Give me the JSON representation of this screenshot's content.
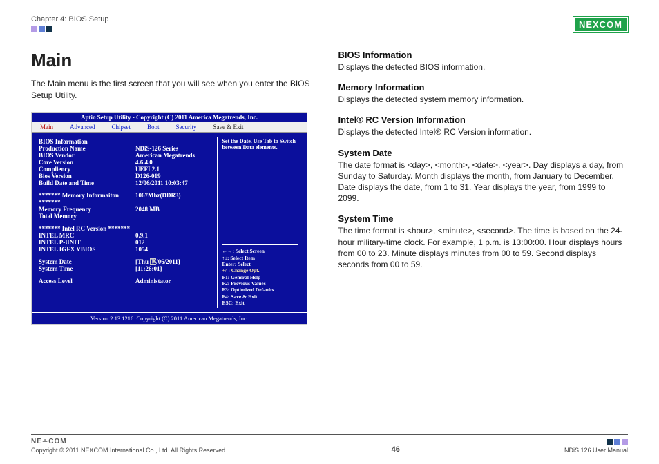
{
  "header": {
    "chapter": "Chapter 4: BIOS Setup",
    "logo_text": "NEXCOM"
  },
  "left": {
    "title": "Main",
    "intro": "The Main menu is the first screen that you will see when you enter the BIOS Setup Utility."
  },
  "bios": {
    "topbar": "Aptio Setup Utility - Copyright (C) 2011 America Megatrends, Inc.",
    "tabs": {
      "main": "Main",
      "advanced": "Advanced",
      "chipset": "Chipset",
      "boot": "Boot",
      "security": "Security",
      "save": "Save & Exit"
    },
    "info_header": "BIOS Information",
    "rows": {
      "production_name": {
        "label": "Production Name",
        "value": "NDiS-126 Series"
      },
      "bios_vendor": {
        "label": "BIOS Vendor",
        "value": "American Megatrends"
      },
      "core_version": {
        "label": "Core Version",
        "value": "4.6.4.0"
      },
      "compliency": {
        "label": "Compliency",
        "value": "UEFI 2.1"
      },
      "bios_version": {
        "label": "Bios Version",
        "value": "D126-019"
      },
      "build_date": {
        "label": "Build Date and Time",
        "value": "12/06/2011  10:03:47"
      }
    },
    "mem_header": "******* Memory Informaiton *******",
    "mem": {
      "freq": {
        "label": "Memory Frequency",
        "value": "2048 MB"
      },
      "freq_suffix": "1067Mhz(DDR3)",
      "total": {
        "label": "Total Memory",
        "value": ""
      }
    },
    "rc_header": "******* Intel RC Version *******",
    "rc": {
      "mrc": {
        "label": "INTEL MRC",
        "value": "0.9.1"
      },
      "punit": {
        "label": "INTEL P-UNIT",
        "value": "012"
      },
      "vbios": {
        "label": "INTEL IGFX VBIOS",
        "value": "1054"
      }
    },
    "sysdate": {
      "label": "System Date",
      "value_pre": "[Thu ",
      "value_hi": "12",
      "value_post": "/06/2011]"
    },
    "systime": {
      "label": "System Time",
      "value": "[11:26:01]"
    },
    "access": {
      "label": "Access Level",
      "value": "Administator"
    },
    "help_top": "Set the Date. Use Tab to Switch between Data elements.",
    "keys": {
      "select_screen": "←→: Select Screen",
      "select_item": "↑↓: Select Item",
      "enter": "Enter: Select",
      "change": "+/-: Change Opt.",
      "f1": "F1: General Help",
      "f2": "F2: Previous Values",
      "f3": "F3: Optimized Defaults",
      "f4": "F4: Save & Exit",
      "esc": "ESC: Exit"
    },
    "footer": "Version 2.13.1216. Copyright (C) 2011 American Megatrends, Inc."
  },
  "doc": {
    "s1": {
      "h": "BIOS Information",
      "p": "Displays the detected BIOS information."
    },
    "s2": {
      "h": "Memory Information",
      "p": "Displays the detected system memory information."
    },
    "s3": {
      "h": "Intel® RC Version Information",
      "p": "Displays the detected Intel® RC Version information."
    },
    "s4": {
      "h": "System Date",
      "p": "The date format is <day>, <month>, <date>, <year>. Day displays a day, from Sunday to Saturday. Month displays the month, from January to December. Date displays the date, from 1 to 31. Year displays the year, from 1999 to 2099."
    },
    "s5": {
      "h": "System Time",
      "p": "The time format is <hour>, <minute>, <second>. The time is based on the 24-hour military-time clock. For example, 1 p.m. is 13:00:00. Hour displays hours from 00 to 23. Minute displays minutes from 00 to 59. Second displays seconds from 00 to 59."
    }
  },
  "footer": {
    "logo": "NE∸COM",
    "copyright": "Copyright © 2011 NEXCOM International Co., Ltd. All Rights Reserved.",
    "page": "46",
    "manual": "NDiS 126 User Manual"
  }
}
